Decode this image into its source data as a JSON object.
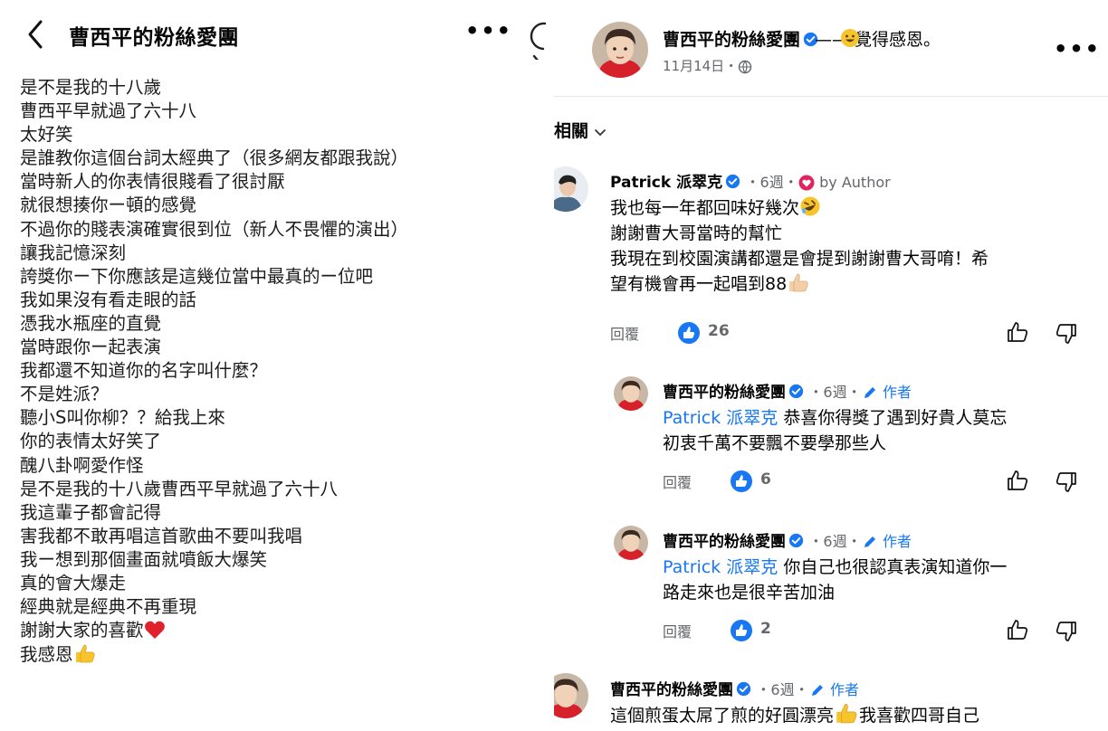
{
  "left": {
    "title": "曹西平的粉絲愛團",
    "more": "•••",
    "lines": [
      "是不是我的十八歲",
      "曹西平早就過了六十八",
      "太好笑",
      "是誰教你這個台詞太經典了（很多網友都跟我說）",
      "當時新人的你表情很賤看了很討厭",
      "就很想揍你ー頓的感覺",
      "不過你的賤表演確實很到位（新人不畏懼的演出）",
      "讓我記憶深刻",
      "誇獎你ー下你應該是這幾位當中最真的ー位吧",
      "我如果沒有看走眼的話",
      "憑我水瓶座的直覺",
      "當時跟你ー起表演",
      "我都還不知道你的名字叫什麼？",
      "不是姓派？",
      "聽小S叫你柳？？給我上來",
      "你的表情太好笑了",
      "醜八卦啊愛作怪",
      "是不是我的十八歲曹西平早就過了六十八",
      "我這輩子都會記得",
      "害我都不敢再唱這首歌曲不要叫我唱",
      "我ー想到那個畫面就噴飯大爆笑",
      "真的會大爆走",
      "經典就是經典不再重現",
      "謝謝大家的喜歡",
      "我感恩"
    ]
  },
  "right": {
    "page_name": "曹西平的粉絲愛團",
    "feeling": "——   覺得感恩。",
    "date": "11月14日・",
    "more": "•••",
    "sort_label": "最相關",
    "comments": [
      {
        "name": "Patrick 派翠克",
        "time": "・6週・",
        "badge": "by Author",
        "lines": [
          "我也每一年都回味好幾次",
          "謝謝曹大哥當時的幫忙",
          "我現在到校園演講都還是會提到謝謝曹大哥唷！希",
          "望有機會再一起唱到88"
        ],
        "reply": "回覆",
        "likes": "26"
      },
      {
        "name": "曹西平的粉絲愛團",
        "time": "・6週・",
        "author": "作者",
        "mention": "Patrick 派翠克",
        "lines": [
          " 恭喜你得獎了遇到好貴人莫忘",
          "初衷千萬不要飄不要學那些人"
        ],
        "reply": "回覆",
        "likes": "6"
      },
      {
        "name": "曹西平的粉絲愛團",
        "time": "・6週・",
        "author": "作者",
        "mention": "Patrick 派翠克",
        "lines": [
          " 你自己也很認真表演知道你一",
          "路走來也是很辛苦加油"
        ],
        "reply": "回覆",
        "likes": "2"
      },
      {
        "name": "曹西平的粉絲愛團",
        "time": "・6週・",
        "author": "作者",
        "lines": [
          "這個煎蛋太屌了煎的好圓漂亮",
          "我喜歡四哥自己"
        ]
      }
    ]
  },
  "colors": {
    "accent": "#1877f2",
    "muted": "#65676b",
    "text": "#050505",
    "heart": "#e0245e"
  },
  "icons": [
    "back-chevron-icon",
    "more-icon",
    "refresh-icon",
    "verified-icon",
    "globe-icon",
    "chevron-down-icon",
    "heart-icon",
    "like-icon",
    "thumb-up-icon",
    "thumb-down-icon",
    "pencil-icon",
    "emoji"
  ]
}
